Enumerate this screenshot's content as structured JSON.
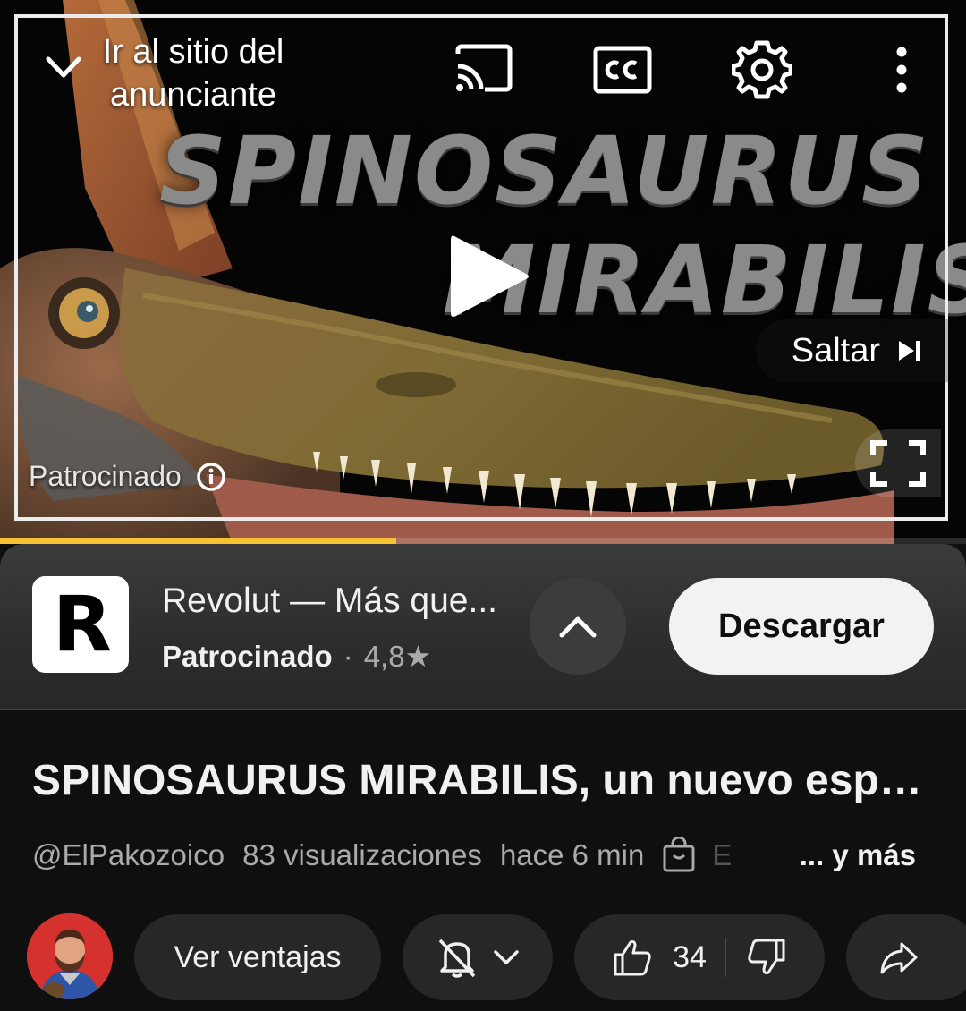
{
  "player": {
    "advertiser_link": "Ir al sitio del anunciante",
    "title_art_line1": "SPINOSAURUS",
    "title_art_line2": "MIRABILIS",
    "skip_label": "Saltar",
    "sponsored_label": "Patrocinado",
    "ad_progress": 0.41,
    "progress_color": "#f5c332",
    "icons": [
      "chevron-down-icon",
      "cast-icon",
      "captions-icon",
      "settings-gear-icon",
      "more-vert-icon",
      "play-icon",
      "skip-next-icon",
      "info-icon",
      "fullscreen-icon"
    ]
  },
  "ad": {
    "logo_letter": "R",
    "title": "Revolut — Más que...",
    "sponsored": "Patrocinado",
    "separator": "·",
    "rating": "4,8",
    "star": "★",
    "download_label": "Descargar"
  },
  "video": {
    "title": "SPINOSAURUS MIRABILIS, un nuevo espécimen",
    "channel": "@ElPakozoico",
    "views": "83 visualizaciones",
    "time": "hace 6 min",
    "faded_text": "E",
    "more": "... y más"
  },
  "actions": {
    "join_label": "Ver ventajas",
    "like_count": "34"
  },
  "colors": {
    "background": "#0f0f0f",
    "pill": "#272727",
    "secondary_text": "#aaaaaa",
    "avatar_bg": "#d5312e"
  }
}
